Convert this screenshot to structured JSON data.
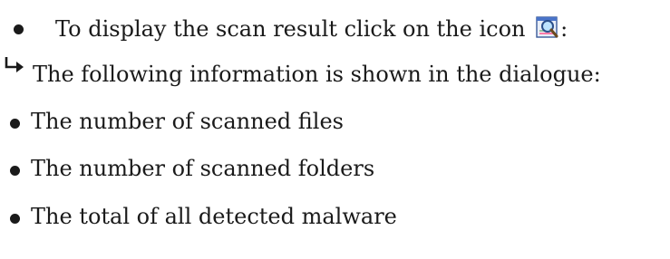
{
  "instruction": {
    "text": "To display the scan result click on the icon",
    "suffix": ":"
  },
  "result_note": {
    "text": "The following information is shown in the dialogue:"
  },
  "result_items": [
    "The number of scanned files",
    "The number of scanned folders",
    "The total of all detected malware"
  ],
  "icons": {
    "result_icon": "magnifier-report-icon",
    "arrow": "return-arrow-icon"
  }
}
